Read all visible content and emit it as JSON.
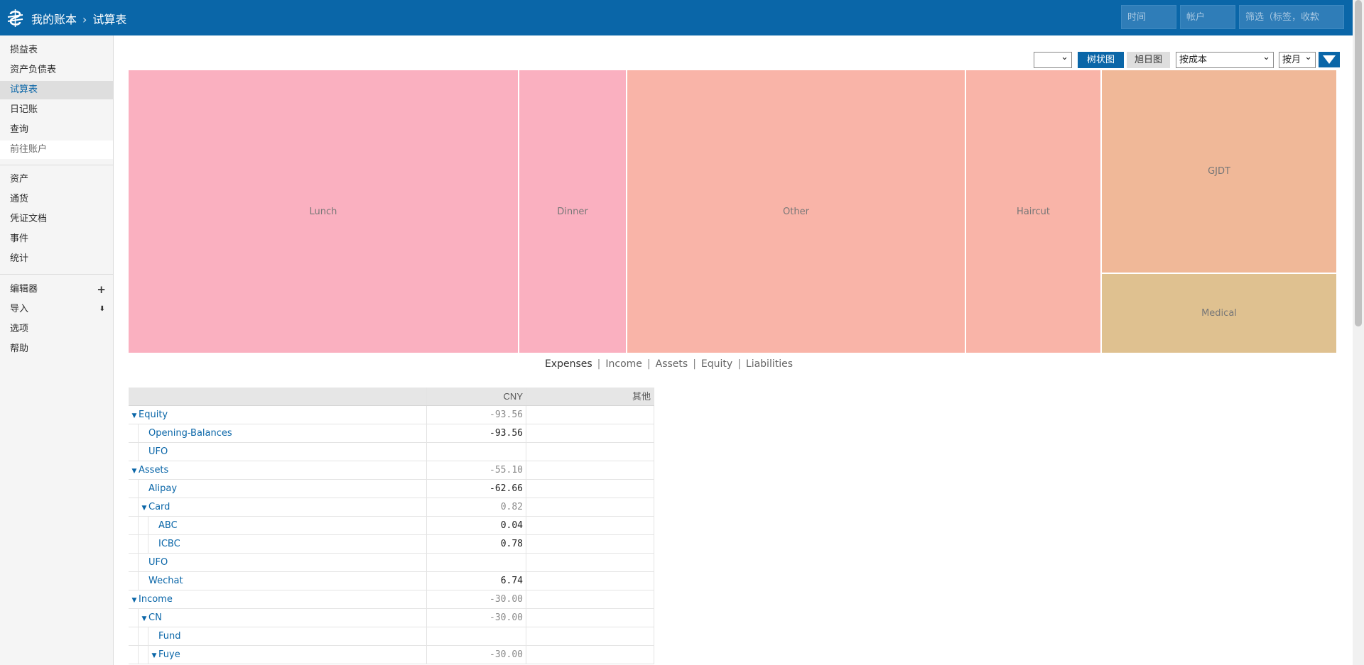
{
  "header": {
    "app_name": "我的账本",
    "breadcrumb_sep": "›",
    "page_title": "试算表",
    "filter_time_placeholder": "时间",
    "filter_account_placeholder": "帐户",
    "filter_tag_placeholder": "筛选（标签，收款"
  },
  "sidebar": {
    "reports": [
      "损益表",
      "资产负债表",
      "试算表",
      "日记账",
      "查询",
      "前往账户"
    ],
    "pages": [
      "资产",
      "通货",
      "凭证文档",
      "事件",
      "统计"
    ],
    "tools": [
      "编辑器",
      "导入",
      "选项",
      "帮助"
    ],
    "editor_icon": "+",
    "import_icon": "⬇"
  },
  "controls": {
    "currency_select": "",
    "treemap_button": "树状图",
    "sunburst_button": "旭日图",
    "conversion_select": "按成本",
    "interval_select": "按月",
    "accent": "#0a66a8"
  },
  "chart_data": {
    "type": "treemap",
    "root": "Expenses",
    "nodes": [
      {
        "label": "Lunch",
        "color": "#fab0c0"
      },
      {
        "label": "Dinner",
        "color": "#fab0c0"
      },
      {
        "label": "Other",
        "color": "#f9b4a8"
      },
      {
        "label": "Haircut",
        "color": "#f9b4a8"
      },
      {
        "label": "GJDT",
        "color": "#f0b898"
      },
      {
        "label": "Medical",
        "color": "#dfc190"
      }
    ]
  },
  "chart_tabs": [
    "Expenses",
    "Income",
    "Assets",
    "Equity",
    "Liabilities"
  ],
  "table": {
    "headers": {
      "account": "",
      "cny": "CNY",
      "other": "其他"
    },
    "rows": [
      {
        "account": "Equity",
        "level": 0,
        "toggle": true,
        "cny": "-93.56",
        "muted": true
      },
      {
        "account": "Opening-Balances",
        "level": 1,
        "toggle": false,
        "cny": "-93.56",
        "muted": false
      },
      {
        "account": "UFO",
        "level": 1,
        "toggle": false,
        "cny": "",
        "muted": false
      },
      {
        "account": "Assets",
        "level": 0,
        "toggle": true,
        "cny": "-55.10",
        "muted": true
      },
      {
        "account": "Alipay",
        "level": 1,
        "toggle": false,
        "cny": "-62.66",
        "muted": false
      },
      {
        "account": "Card",
        "level": 1,
        "toggle": true,
        "cny": "0.82",
        "muted": true
      },
      {
        "account": "ABC",
        "level": 2,
        "toggle": false,
        "cny": "0.04",
        "muted": false
      },
      {
        "account": "ICBC",
        "level": 2,
        "toggle": false,
        "cny": "0.78",
        "muted": false
      },
      {
        "account": "UFO",
        "level": 1,
        "toggle": false,
        "cny": "",
        "muted": false
      },
      {
        "account": "Wechat",
        "level": 1,
        "toggle": false,
        "cny": "6.74",
        "muted": false
      },
      {
        "account": "Income",
        "level": 0,
        "toggle": true,
        "cny": "-30.00",
        "muted": true
      },
      {
        "account": "CN",
        "level": 1,
        "toggle": true,
        "cny": "-30.00",
        "muted": true
      },
      {
        "account": "Fund",
        "level": 2,
        "toggle": false,
        "cny": "",
        "muted": false
      },
      {
        "account": "Fuye",
        "level": 2,
        "toggle": true,
        "cny": "-30.00",
        "muted": true
      }
    ]
  }
}
